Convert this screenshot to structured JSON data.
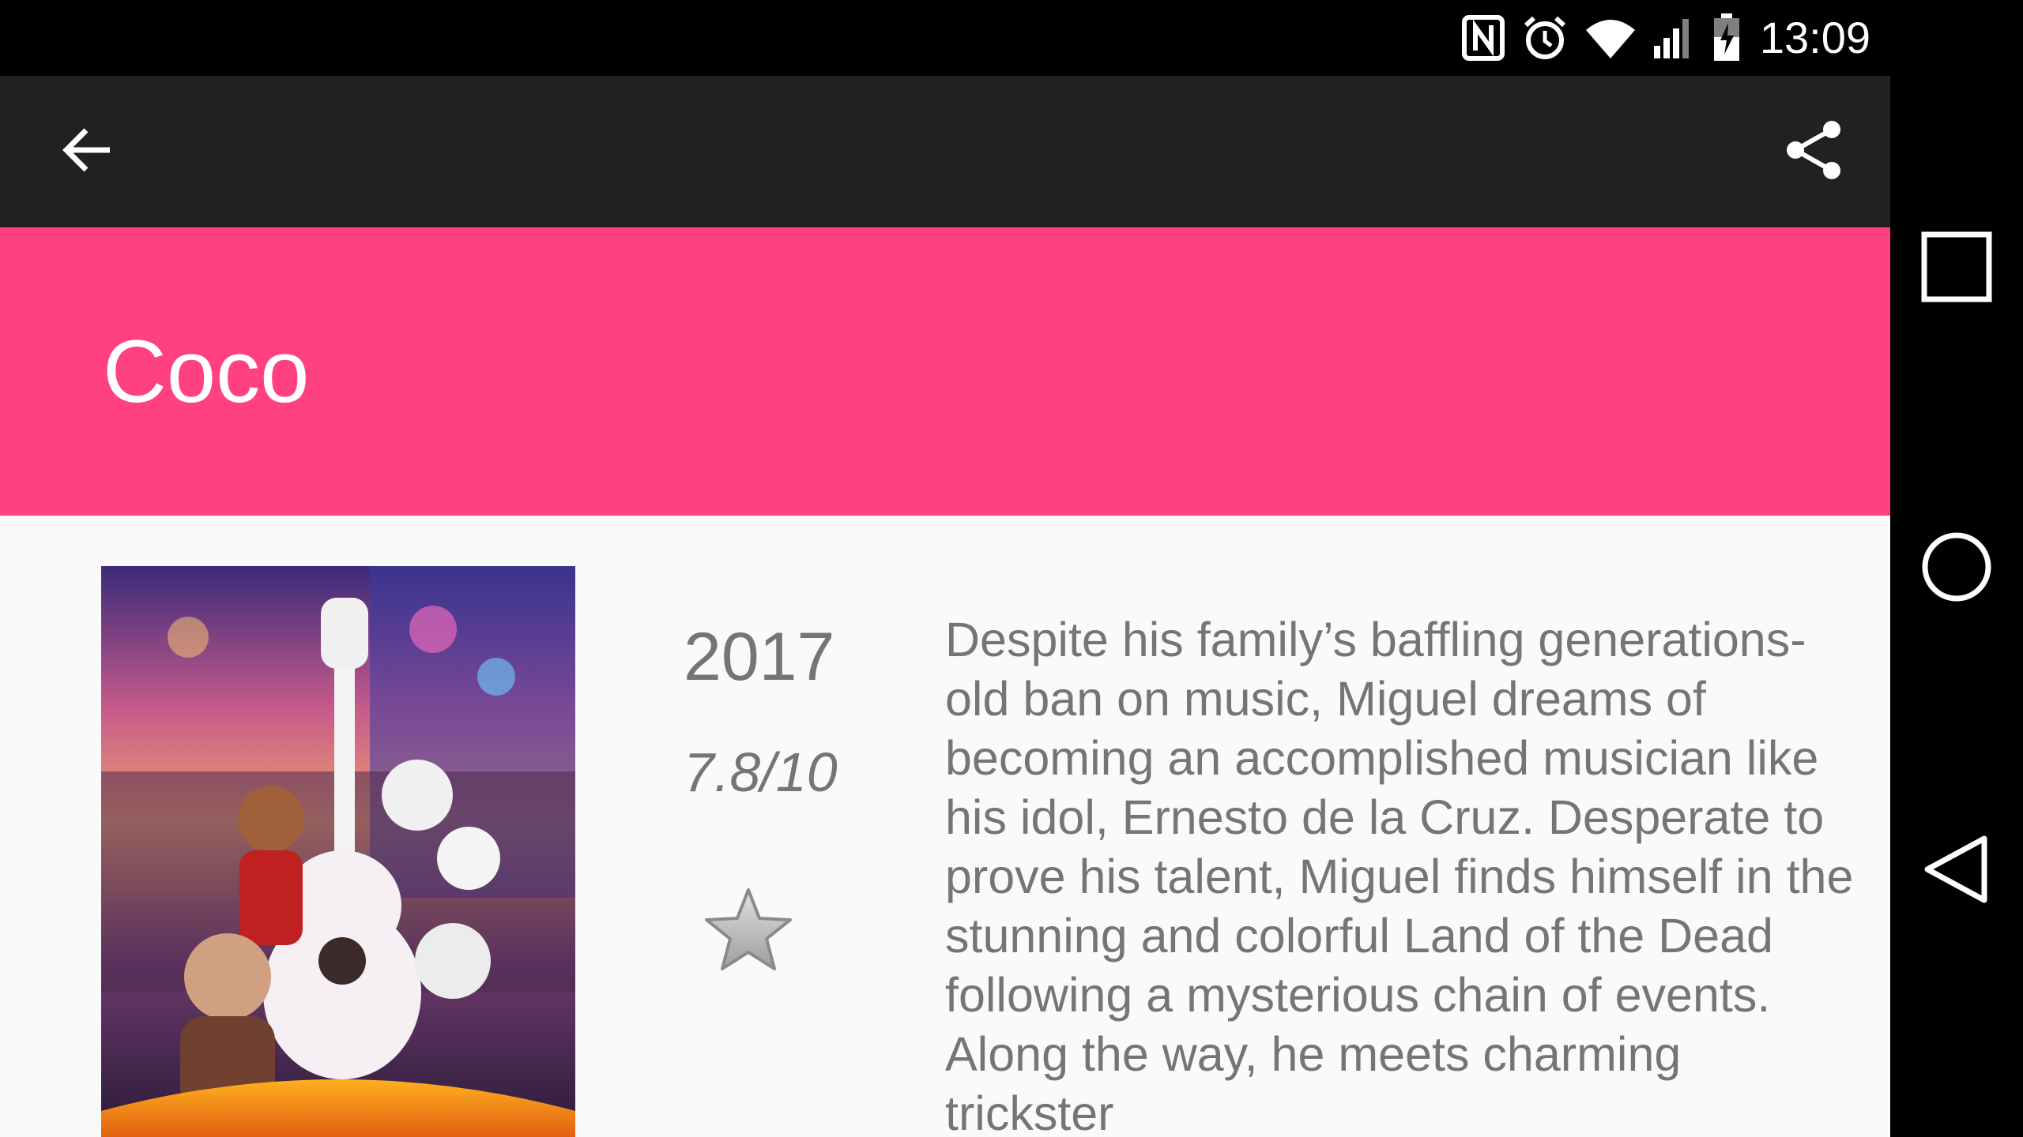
{
  "status_bar": {
    "time": "13:09",
    "icons": [
      "nfc-icon",
      "alarm-icon",
      "wifi-icon",
      "signal-icon",
      "battery-charging-icon"
    ]
  },
  "toolbar": {
    "back_icon": "arrow-back-icon",
    "share_icon": "share-icon"
  },
  "movie": {
    "title": "Coco",
    "year": "2017",
    "rating": "7.8/10",
    "favorite_icon": "star-icon",
    "overview": "Despite his family’s baffling generations-old ban on music, Miguel dreams of becoming an accomplished musician like his idol, Ernesto de la Cruz. Desperate to prove his talent, Miguel finds himself in the stunning and colorful Land of the Dead following a mysterious chain of events. Along the way, he meets charming trickster"
  },
  "nav_bar": {
    "buttons": [
      "recents-icon",
      "home-icon",
      "back-icon"
    ]
  },
  "colors": {
    "accent": "#ff4081",
    "toolbar": "#212121",
    "content_bg": "#fafafa",
    "text_secondary": "#757575"
  }
}
